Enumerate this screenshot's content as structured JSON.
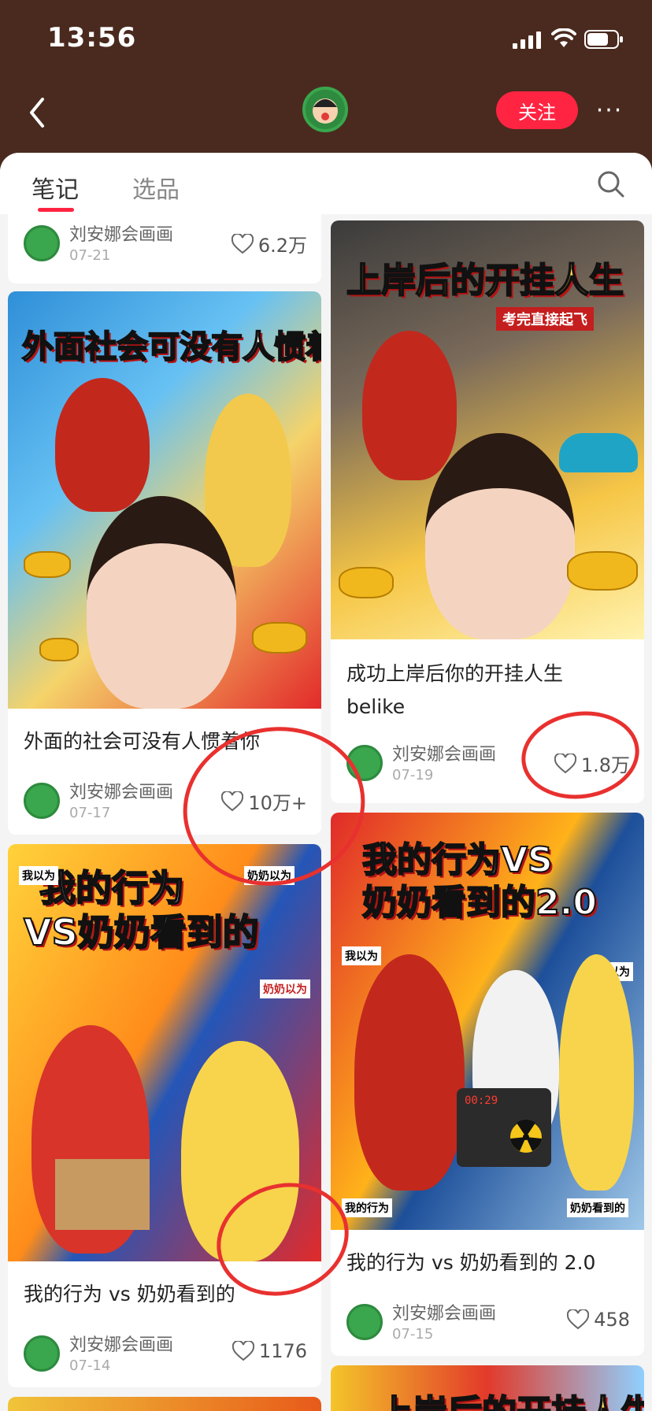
{
  "status_bar": {
    "time": "13:56"
  },
  "header": {
    "follow_label": "关注",
    "more_label": "···"
  },
  "tabs": [
    {
      "label": "笔记"
    },
    {
      "label": "选品"
    }
  ],
  "cards": [
    {
      "title": "",
      "author": "刘安娜会画画",
      "date": "07-21",
      "likes": "6.2万"
    },
    {
      "cover_headline": "外面社会可没有人惯着你",
      "title": "外面的社会可没有人惯着你",
      "author": "刘安娜会画画",
      "date": "07-17",
      "likes": "10万+"
    },
    {
      "cover_headline": "上岸后的开挂人生",
      "cover_subheadline": "考完直接起飞",
      "title": "成功上岸后你的开挂人生",
      "title_line2": "belike",
      "author": "刘安娜会画画",
      "date": "07-19",
      "likes": "1.8万"
    },
    {
      "cover_headline": "我的行为",
      "cover_headline2": "VS奶奶看到的",
      "cover_tag1": "我以为",
      "cover_tag2": "奶奶以为",
      "cover_tag3": "奶奶以为",
      "title": "我的行为 vs 奶奶看到的",
      "author": "刘安娜会画画",
      "date": "07-14",
      "likes": "1176"
    },
    {
      "cover_headline": "我的行为VS",
      "cover_headline2": "奶奶看到的2.0",
      "cover_tag1": "我以为",
      "cover_tag2": "奶奶以为",
      "cover_tag3": "我的行为",
      "cover_tag4": "奶奶看到的",
      "cover_timer": "00:29",
      "title": "我的行为 vs 奶奶看到的 2.0",
      "author": "刘安娜会画画",
      "date": "07-15",
      "likes": "458"
    },
    {
      "cover_headline": "上岸后的开挂人生"
    }
  ],
  "colors": {
    "brand_red": "#ff2442",
    "header_bg": "#4a2a1e",
    "annotation_red": "#e8312f"
  }
}
